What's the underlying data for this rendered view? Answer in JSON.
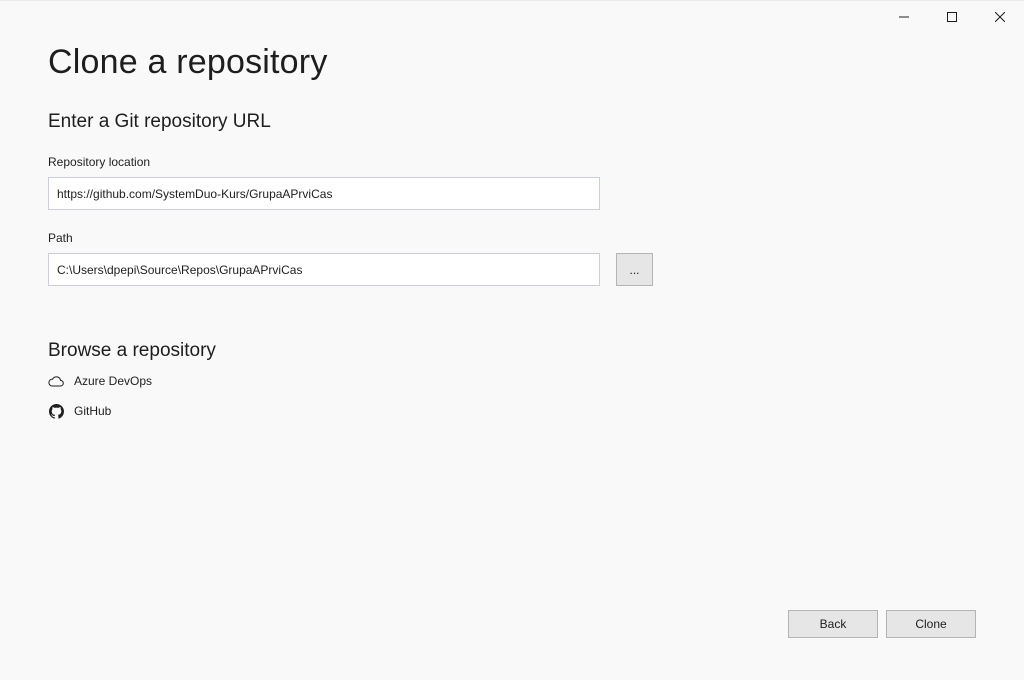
{
  "window": {
    "title": "Clone a repository"
  },
  "clone_url_section": {
    "heading": "Enter a Git repository URL",
    "repository_location_label": "Repository location",
    "repository_location_value": "https://github.com/SystemDuo-Kurs/GrupaAPrviCas",
    "path_label": "Path",
    "path_value": "C:\\Users\\dpepi\\Source\\Repos\\GrupaAPrviCas",
    "browse_button_label": "..."
  },
  "browse_section": {
    "heading": "Browse a repository",
    "providers": [
      {
        "label": "Azure DevOps",
        "icon": "cloud-icon"
      },
      {
        "label": "GitHub",
        "icon": "github-icon"
      }
    ]
  },
  "footer": {
    "back_label": "Back",
    "clone_label": "Clone"
  }
}
